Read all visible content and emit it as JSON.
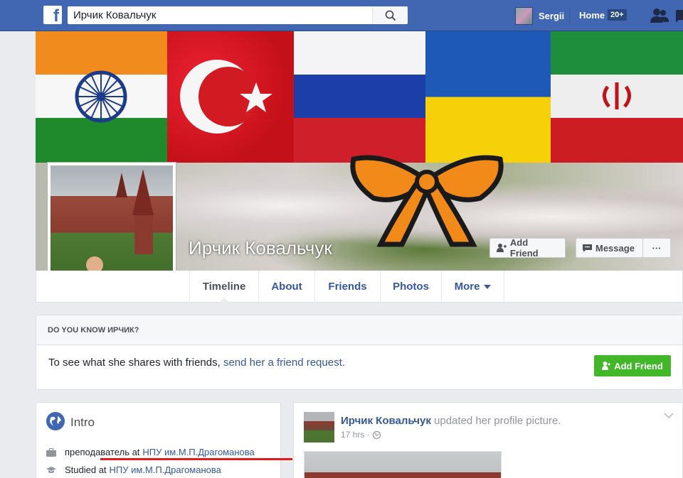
{
  "topbar": {
    "logo": "f",
    "search_value": "Ирчик Ковальчук",
    "user_name": "Sergii",
    "home_label": "Home",
    "home_badge": "20+",
    "accent": "#4267b2"
  },
  "cover": {
    "flags": [
      "India",
      "Turkey",
      "Russia",
      "Ukraine",
      "Iran"
    ],
    "profile_name": "Ирчик Ковальчук",
    "add_friend_label": "Add Friend",
    "message_label": "Message",
    "more_label": "···"
  },
  "nav": {
    "tabs": [
      {
        "label": "Timeline",
        "active": true
      },
      {
        "label": "About",
        "active": false
      },
      {
        "label": "Friends",
        "active": false
      },
      {
        "label": "Photos",
        "active": false
      },
      {
        "label": "More",
        "active": false
      }
    ]
  },
  "know": {
    "heading": "DO YOU KNOW ИРЧИК?",
    "text": "To see what she shares with friends,",
    "link": "send her a friend request.",
    "button": "Add Friend",
    "button_color": "#42b72a"
  },
  "intro": {
    "title": "Intro",
    "work_role": "преподаватель at",
    "work_place": "НПУ им.М.П.Драгоманова",
    "study_prefix": "Studied at",
    "study_place": "НПУ им.М.П.Драгоманова",
    "highlight_color": "#e41b1b"
  },
  "post": {
    "author": "Ирчик Ковальчук",
    "action": "updated her profile picture.",
    "time": "17 hrs ·"
  }
}
